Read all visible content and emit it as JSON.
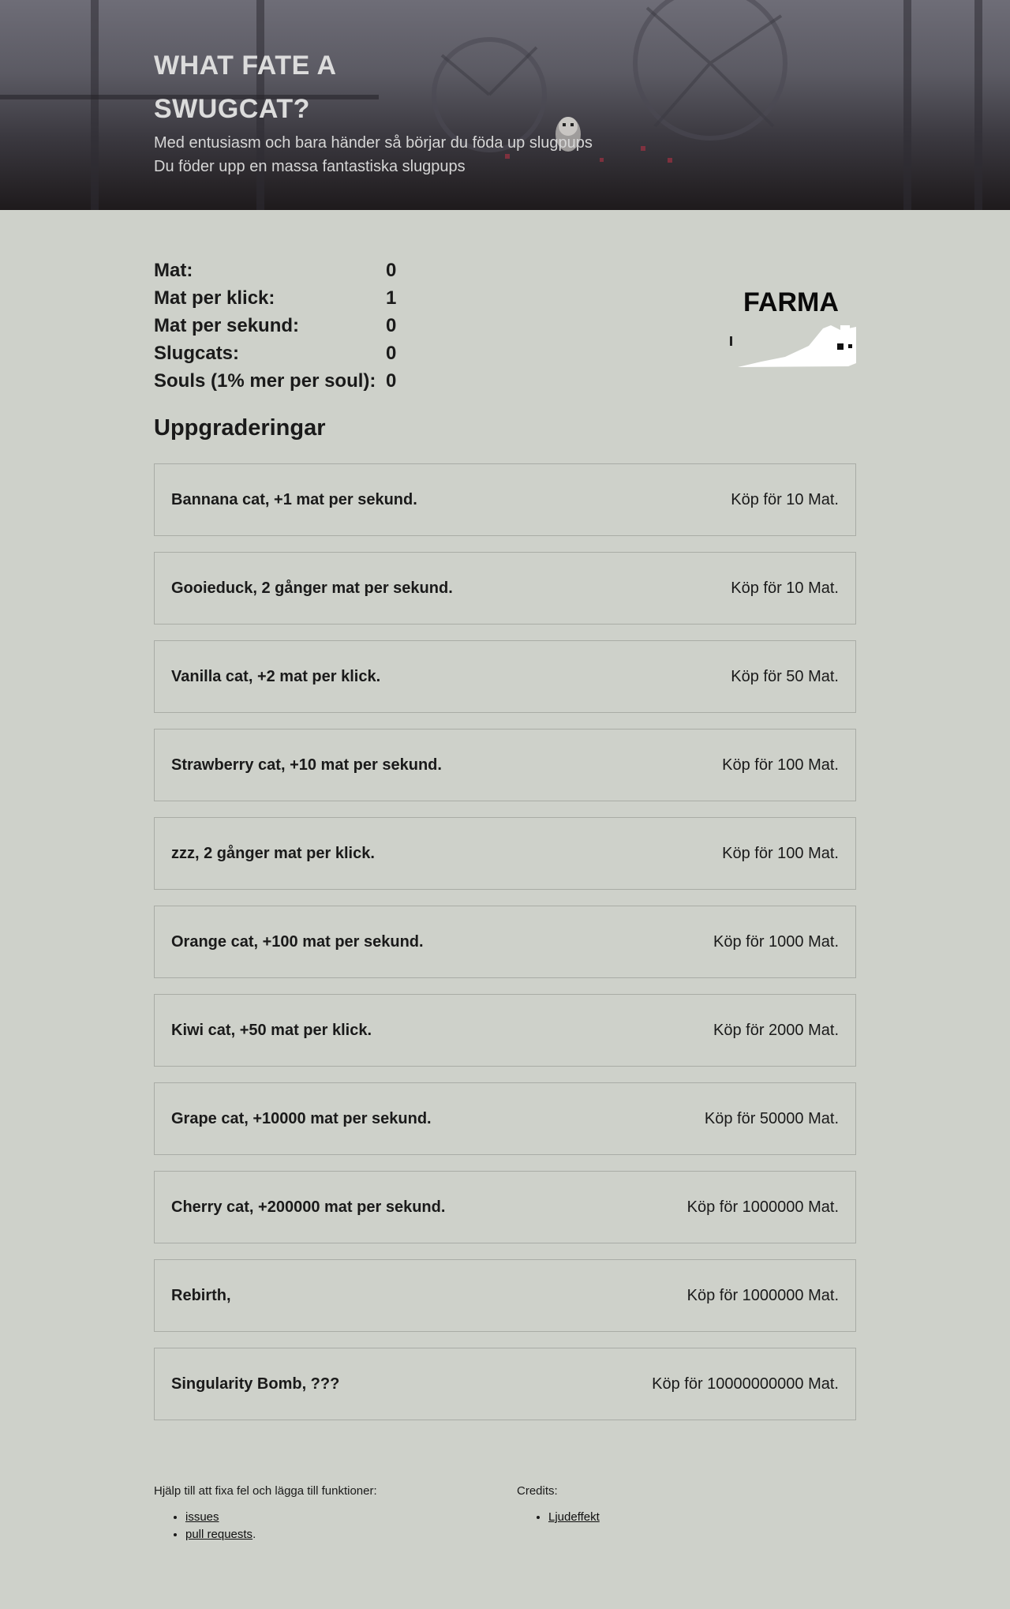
{
  "hero": {
    "title": "WHAT FATE A SWUGCAT?",
    "line1": "Med entusiasm och bara händer så börjar du föda up slugpups",
    "line2": "Du föder upp en massa fantastiska slugpups"
  },
  "stats": [
    {
      "label": "Mat:",
      "value": "0"
    },
    {
      "label": "Mat per klick:",
      "value": "1"
    },
    {
      "label": "Mat per sekund:",
      "value": "0"
    },
    {
      "label": "Slugcats:",
      "value": "0"
    },
    {
      "label": "Souls (1% mer per soul):",
      "value": "0"
    }
  ],
  "farma": {
    "label": "FARMA"
  },
  "upgrades_title": "Uppgraderingar",
  "upgrades": [
    {
      "name": "Bannana cat, +1 mat per sekund.",
      "cost": "Köp för 10 Mat."
    },
    {
      "name": "Gooieduck, 2 gånger mat per sekund.",
      "cost": "Köp för 10 Mat."
    },
    {
      "name": "Vanilla cat, +2 mat per klick.",
      "cost": "Köp för 50 Mat."
    },
    {
      "name": "Strawberry cat, +10 mat per sekund.",
      "cost": "Köp för 100 Mat."
    },
    {
      "name": "zzz, 2 gånger mat per klick.",
      "cost": "Köp för 100 Mat."
    },
    {
      "name": "Orange cat, +100 mat per sekund.",
      "cost": "Köp för 1000 Mat."
    },
    {
      "name": "Kiwi cat, +50 mat per klick.",
      "cost": "Köp för 2000 Mat."
    },
    {
      "name": "Grape cat, +10000 mat per sekund.",
      "cost": "Köp för 50000 Mat."
    },
    {
      "name": "Cherry cat, +200000 mat per sekund.",
      "cost": "Köp för 1000000 Mat."
    },
    {
      "name": "Rebirth,",
      "cost": "Köp för 1000000 Mat."
    },
    {
      "name": "Singularity Bomb, ???",
      "cost": "Köp för 10000000000 Mat."
    }
  ],
  "footer": {
    "help_text": "Hjälp till att fixa fel och lägga till funktioner:",
    "help_links": [
      "issues",
      "pull requests"
    ],
    "help_suffix": ".",
    "credits_text": "Credits:",
    "credits_links": [
      "Ljudeffekt"
    ]
  }
}
